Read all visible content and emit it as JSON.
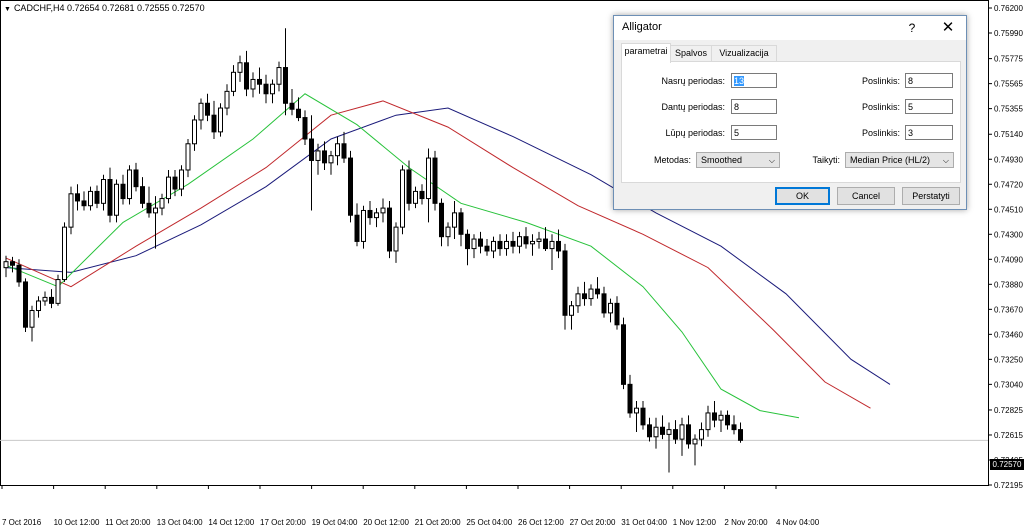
{
  "chart": {
    "symbol_line": "CADCHF,H4  0.72654 0.72681 0.72555 0.72570",
    "current_price": "0.72570",
    "price_labels": [
      "0.76200",
      "0.75990",
      "0.75775",
      "0.75565",
      "0.75355",
      "0.75140",
      "0.74930",
      "0.74720",
      "0.74510",
      "0.74300",
      "0.74090",
      "0.73880",
      "0.73670",
      "0.73460",
      "0.73250",
      "0.73040",
      "0.72825",
      "0.72615",
      "0.72405",
      "0.72195"
    ],
    "time_labels": [
      "7 Oct 2016",
      "10 Oct 12:00",
      "11 Oct 20:00",
      "13 Oct 04:00",
      "14 Oct 12:00",
      "17 Oct 20:00",
      "19 Oct 04:00",
      "20 Oct 12:00",
      "21 Oct 20:00",
      "25 Oct 04:00",
      "26 Oct 12:00",
      "27 Oct 20:00",
      "31 Oct 04:00",
      "1 Nov 12:00",
      "2 Nov 20:00",
      "4 Nov 04:00"
    ],
    "colors": {
      "bull": "#000000",
      "bear": "#000000",
      "jaw": "#1a1a7a",
      "teeth": "#c0282c",
      "lips": "#27c23a"
    }
  },
  "chart_data": {
    "type": "candlestick",
    "instrument": "CADCHF",
    "timeframe": "H4",
    "ohlc": [
      [
        0.7402,
        0.7412,
        0.7394,
        0.7407
      ],
      [
        0.7407,
        0.7411,
        0.7398,
        0.7404
      ],
      [
        0.7404,
        0.7409,
        0.7386,
        0.739
      ],
      [
        0.739,
        0.7393,
        0.7348,
        0.7352
      ],
      [
        0.7352,
        0.737,
        0.734,
        0.7366
      ],
      [
        0.7366,
        0.7378,
        0.736,
        0.7374
      ],
      [
        0.7374,
        0.7382,
        0.737,
        0.7377
      ],
      [
        0.7377,
        0.7384,
        0.7368,
        0.7372
      ],
      [
        0.7372,
        0.7396,
        0.737,
        0.7392
      ],
      [
        0.7392,
        0.744,
        0.739,
        0.7436
      ],
      [
        0.7436,
        0.747,
        0.743,
        0.7464
      ],
      [
        0.7464,
        0.7472,
        0.745,
        0.7458
      ],
      [
        0.7458,
        0.7466,
        0.745,
        0.7454
      ],
      [
        0.7454,
        0.747,
        0.745,
        0.7466
      ],
      [
        0.7466,
        0.7471,
        0.7452,
        0.7456
      ],
      [
        0.7456,
        0.748,
        0.745,
        0.7476
      ],
      [
        0.7476,
        0.7486,
        0.744,
        0.7446
      ],
      [
        0.7446,
        0.7476,
        0.744,
        0.7472
      ],
      [
        0.7472,
        0.748,
        0.7455,
        0.746
      ],
      [
        0.746,
        0.7488,
        0.7455,
        0.7484
      ],
      [
        0.7484,
        0.749,
        0.7466,
        0.747
      ],
      [
        0.747,
        0.7478,
        0.7452,
        0.7456
      ],
      [
        0.7456,
        0.747,
        0.7444,
        0.7448
      ],
      [
        0.7448,
        0.7462,
        0.7418,
        0.7452
      ],
      [
        0.7452,
        0.7464,
        0.7446,
        0.746
      ],
      [
        0.746,
        0.7484,
        0.7456,
        0.7478
      ],
      [
        0.7478,
        0.7484,
        0.7462,
        0.7468
      ],
      [
        0.7468,
        0.7488,
        0.7462,
        0.7484
      ],
      [
        0.7484,
        0.751,
        0.7478,
        0.7506
      ],
      [
        0.7506,
        0.753,
        0.75,
        0.7526
      ],
      [
        0.7526,
        0.7544,
        0.7518,
        0.754
      ],
      [
        0.754,
        0.7548,
        0.7525,
        0.753
      ],
      [
        0.753,
        0.7542,
        0.751,
        0.7516
      ],
      [
        0.7516,
        0.754,
        0.7512,
        0.7536
      ],
      [
        0.7536,
        0.7556,
        0.753,
        0.755
      ],
      [
        0.755,
        0.7572,
        0.7546,
        0.7566
      ],
      [
        0.7566,
        0.758,
        0.7558,
        0.7574
      ],
      [
        0.7574,
        0.7584,
        0.7546,
        0.7552
      ],
      [
        0.7552,
        0.7566,
        0.7545,
        0.756
      ],
      [
        0.756,
        0.757,
        0.7548,
        0.7556
      ],
      [
        0.7556,
        0.7564,
        0.754,
        0.7548
      ],
      [
        0.7548,
        0.756,
        0.754,
        0.7556
      ],
      [
        0.7556,
        0.7575,
        0.755,
        0.757
      ],
      [
        0.757,
        0.7603,
        0.753,
        0.754
      ],
      [
        0.754,
        0.7552,
        0.753,
        0.7535
      ],
      [
        0.7535,
        0.7545,
        0.7525,
        0.7528
      ],
      [
        0.7528,
        0.7534,
        0.7505,
        0.751
      ],
      [
        0.751,
        0.753,
        0.745,
        0.7492
      ],
      [
        0.7492,
        0.7506,
        0.748,
        0.75
      ],
      [
        0.75,
        0.7508,
        0.7484,
        0.749
      ],
      [
        0.749,
        0.75,
        0.748,
        0.7496
      ],
      [
        0.7496,
        0.7512,
        0.7488,
        0.7506
      ],
      [
        0.7506,
        0.7516,
        0.749,
        0.7494
      ],
      [
        0.7494,
        0.75,
        0.744,
        0.7446
      ],
      [
        0.7446,
        0.7456,
        0.742,
        0.7424
      ],
      [
        0.7424,
        0.7454,
        0.7418,
        0.745
      ],
      [
        0.745,
        0.7458,
        0.7438,
        0.7444
      ],
      [
        0.7444,
        0.7452,
        0.7436,
        0.7448
      ],
      [
        0.7448,
        0.746,
        0.744,
        0.7452
      ],
      [
        0.7452,
        0.7458,
        0.741,
        0.7416
      ],
      [
        0.7416,
        0.744,
        0.7406,
        0.7436
      ],
      [
        0.7436,
        0.7488,
        0.743,
        0.7484
      ],
      [
        0.7484,
        0.7492,
        0.745,
        0.7456
      ],
      [
        0.7456,
        0.747,
        0.7452,
        0.7466
      ],
      [
        0.7466,
        0.7472,
        0.7455,
        0.746
      ],
      [
        0.746,
        0.7502,
        0.744,
        0.7494
      ],
      [
        0.7494,
        0.75,
        0.745,
        0.7456
      ],
      [
        0.7456,
        0.746,
        0.742,
        0.7428
      ],
      [
        0.7428,
        0.744,
        0.742,
        0.7436
      ],
      [
        0.7436,
        0.7458,
        0.7426,
        0.7448
      ],
      [
        0.7448,
        0.7452,
        0.742,
        0.743
      ],
      [
        0.743,
        0.7434,
        0.7404,
        0.7418
      ],
      [
        0.7418,
        0.743,
        0.741,
        0.7426
      ],
      [
        0.7426,
        0.7432,
        0.7414,
        0.742
      ],
      [
        0.742,
        0.7426,
        0.7412,
        0.7416
      ],
      [
        0.7416,
        0.7428,
        0.741,
        0.7424
      ],
      [
        0.7424,
        0.743,
        0.7412,
        0.7418
      ],
      [
        0.7418,
        0.743,
        0.7412,
        0.7424
      ],
      [
        0.7424,
        0.7432,
        0.7414,
        0.742
      ],
      [
        0.742,
        0.7432,
        0.7414,
        0.7428
      ],
      [
        0.7428,
        0.7436,
        0.7418,
        0.7422
      ],
      [
        0.7422,
        0.743,
        0.7412,
        0.7424
      ],
      [
        0.7424,
        0.7432,
        0.7418,
        0.7426
      ],
      [
        0.7426,
        0.7436,
        0.7416,
        0.7418
      ],
      [
        0.7418,
        0.743,
        0.74,
        0.7424
      ],
      [
        0.7424,
        0.7434,
        0.741,
        0.7416
      ],
      [
        0.7416,
        0.7422,
        0.735,
        0.7362
      ],
      [
        0.7362,
        0.7374,
        0.735,
        0.737
      ],
      [
        0.737,
        0.7386,
        0.7364,
        0.738
      ],
      [
        0.738,
        0.739,
        0.737,
        0.7376
      ],
      [
        0.7376,
        0.7388,
        0.737,
        0.7384
      ],
      [
        0.7384,
        0.7394,
        0.7376,
        0.738
      ],
      [
        0.738,
        0.7386,
        0.736,
        0.7364
      ],
      [
        0.7364,
        0.7376,
        0.7356,
        0.7372
      ],
      [
        0.7372,
        0.7378,
        0.735,
        0.7354
      ],
      [
        0.7354,
        0.736,
        0.73,
        0.7304
      ],
      [
        0.7304,
        0.7312,
        0.7276,
        0.728
      ],
      [
        0.728,
        0.729,
        0.7264,
        0.7284
      ],
      [
        0.7284,
        0.729,
        0.7266,
        0.727
      ],
      [
        0.727,
        0.7276,
        0.7256,
        0.726
      ],
      [
        0.726,
        0.7276,
        0.725,
        0.7268
      ],
      [
        0.7268,
        0.7278,
        0.7258,
        0.7262
      ],
      [
        0.7262,
        0.7272,
        0.723,
        0.7266
      ],
      [
        0.7266,
        0.7274,
        0.7254,
        0.7258
      ],
      [
        0.7258,
        0.7276,
        0.7244,
        0.727
      ],
      [
        0.727,
        0.7278,
        0.725,
        0.7254
      ],
      [
        0.7254,
        0.7262,
        0.7236,
        0.7258
      ],
      [
        0.7258,
        0.7272,
        0.7252,
        0.7266
      ],
      [
        0.7266,
        0.7286,
        0.726,
        0.728
      ],
      [
        0.728,
        0.729,
        0.7268,
        0.7274
      ],
      [
        0.7274,
        0.7282,
        0.7264,
        0.7278
      ],
      [
        0.7278,
        0.7282,
        0.7266,
        0.727
      ],
      [
        0.727,
        0.7278,
        0.7262,
        0.7266
      ],
      [
        0.7266,
        0.7272,
        0.7255,
        0.7257
      ]
    ],
    "jaw": [
      [
        0,
        0.7402
      ],
      [
        10,
        0.7398
      ],
      [
        20,
        0.7412
      ],
      [
        30,
        0.7438
      ],
      [
        40,
        0.747
      ],
      [
        50,
        0.751
      ],
      [
        60,
        0.753
      ],
      [
        68,
        0.7536
      ],
      [
        78,
        0.7512
      ],
      [
        90,
        0.748
      ],
      [
        100,
        0.7448
      ],
      [
        110,
        0.742
      ],
      [
        120,
        0.738
      ],
      [
        130,
        0.7325
      ],
      [
        136,
        0.7304
      ]
    ],
    "teeth": [
      [
        0,
        0.741
      ],
      [
        10,
        0.7386
      ],
      [
        20,
        0.742
      ],
      [
        30,
        0.7452
      ],
      [
        40,
        0.7486
      ],
      [
        50,
        0.753
      ],
      [
        58,
        0.7542
      ],
      [
        68,
        0.752
      ],
      [
        78,
        0.7486
      ],
      [
        88,
        0.7454
      ],
      [
        98,
        0.743
      ],
      [
        108,
        0.7402
      ],
      [
        118,
        0.735
      ],
      [
        126,
        0.7306
      ],
      [
        133,
        0.7284
      ]
    ],
    "lips": [
      [
        0,
        0.7404
      ],
      [
        8,
        0.7386
      ],
      [
        18,
        0.744
      ],
      [
        28,
        0.7472
      ],
      [
        38,
        0.751
      ],
      [
        46,
        0.7548
      ],
      [
        54,
        0.7522
      ],
      [
        62,
        0.7486
      ],
      [
        70,
        0.7456
      ],
      [
        80,
        0.744
      ],
      [
        90,
        0.742
      ],
      [
        98,
        0.7386
      ],
      [
        104,
        0.7348
      ],
      [
        110,
        0.73
      ],
      [
        116,
        0.7282
      ],
      [
        122,
        0.7276
      ]
    ],
    "ylim": [
      0.72195,
      0.762
    ]
  },
  "dialog": {
    "title": "Alligator",
    "help": "?",
    "close": "✕",
    "tabs": [
      "parametrai",
      "Spalvos",
      "Vizualizacija"
    ],
    "fields": [
      {
        "label": "Nasrų periodas:",
        "value": "13",
        "shift_label": "Poslinkis:",
        "shift": "8"
      },
      {
        "label": "Dantų periodas:",
        "value": "8",
        "shift_label": "Poslinkis:",
        "shift": "5"
      },
      {
        "label": "Lūpų periodas:",
        "value": "5",
        "shift_label": "Poslinkis:",
        "shift": "3"
      }
    ],
    "method_label": "Metodas:",
    "method_value": "Smoothed",
    "apply_label": "Taikyti:",
    "apply_value": "Median Price (HL/2)",
    "ok": "OK",
    "cancel": "Cancel",
    "reset": "Perstatyti"
  }
}
